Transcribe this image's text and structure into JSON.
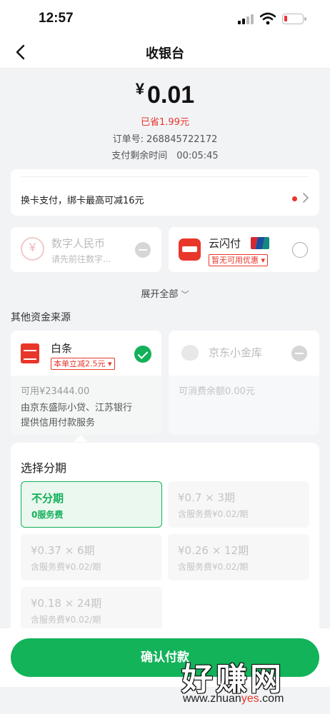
{
  "status_bar": {
    "time": "12:57"
  },
  "nav": {
    "title": "收银台"
  },
  "payment": {
    "currency_symbol": "¥",
    "amount": "0.01",
    "saved": "已省1.99元",
    "order_number": "订单号: 268845722172",
    "remaining_time": "支付剩余时间　00:05:45"
  },
  "switch_card": {
    "text": "换卡支付，绑卡最高可减16元"
  },
  "methods": {
    "digital_rmb": {
      "title": "数字人民币",
      "subtitle": "请先前往数字..."
    },
    "yunshanfu": {
      "title": "云闪付",
      "tag": "暂无可用优惠"
    }
  },
  "expand_all": "展开全部",
  "other_sources_label": "其他资金来源",
  "baitiao": {
    "title": "白条",
    "tag": "本单立减2.5元",
    "available": "可用¥23444.00",
    "provider_line1": "由京东盛际小贷、江苏银行",
    "provider_line2": "提供信用付款服务"
  },
  "xiaojinku": {
    "title": "京东小金库",
    "balance": "可消费余额0.00元"
  },
  "installments": {
    "title": "选择分期",
    "plans": [
      {
        "main": "不分期",
        "sub": "0服务费",
        "selected": true
      },
      {
        "main": "¥0.7 × 3期",
        "sub": "含服务费¥0.02/期",
        "selected": false
      },
      {
        "main": "¥0.37 × 6期",
        "sub": "含服务费¥0.02/期",
        "selected": false
      },
      {
        "main": "¥0.26 × 12期",
        "sub": "含服务费¥0.02/期",
        "selected": false
      },
      {
        "main": "¥0.18 × 24期",
        "sub": "含服务费¥0.02/期",
        "selected": false
      }
    ]
  },
  "confirm_button": "确认付款",
  "watermark": {
    "brand": "好赚网",
    "url_prefix": "www.zhuan",
    "url_highlight": "yes",
    "url_suffix": ".com"
  },
  "colors": {
    "accent_green": "#13b35a",
    "promo_red": "#e8362b"
  }
}
